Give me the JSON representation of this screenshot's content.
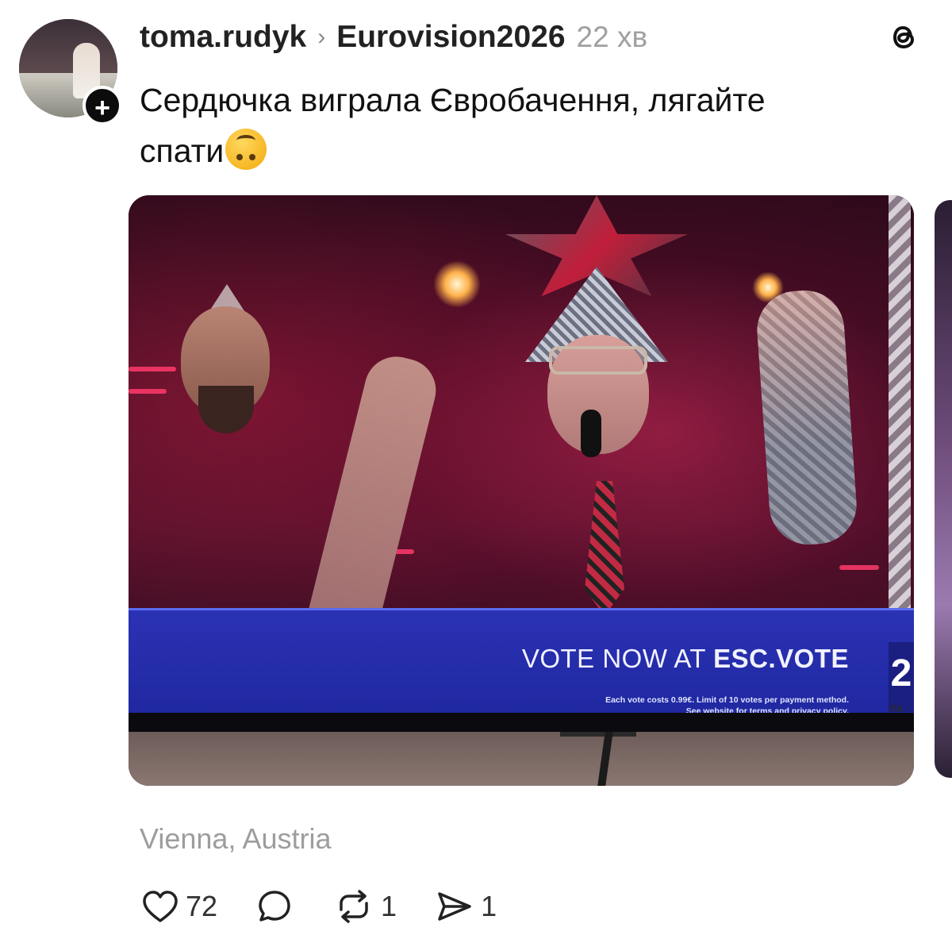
{
  "post": {
    "author": "toma.rudyk",
    "chevron": "›",
    "topic": "Eurovision2026",
    "time": "22 хв",
    "text_line1": "Сердючка виграла Євробачення, лягайте",
    "text_line2": "спати",
    "emoji": "upside-down-face-icon",
    "location": "Vienna, Austria"
  },
  "media": {
    "vote_prefix": "VOTE NOW AT ",
    "vote_site": "ESC.VOTE",
    "fine_print_line1": "Each vote costs 0.99€. Limit of 10 votes per payment method.",
    "fine_print_line2": "See website for terms and privacy policy.",
    "badge_digit": "2",
    "badge_country": "ITA"
  },
  "actions": {
    "likes": "72",
    "reposts": "1",
    "shares": "1"
  },
  "icons": {
    "follow": "plus-icon",
    "app": "threads-logo-icon",
    "like": "heart-icon",
    "comment": "comment-icon",
    "repost": "repost-icon",
    "share": "send-icon"
  },
  "colors": {
    "text": "#111111",
    "muted": "#a0a0a0",
    "tv_banner": "#2b32b5"
  }
}
